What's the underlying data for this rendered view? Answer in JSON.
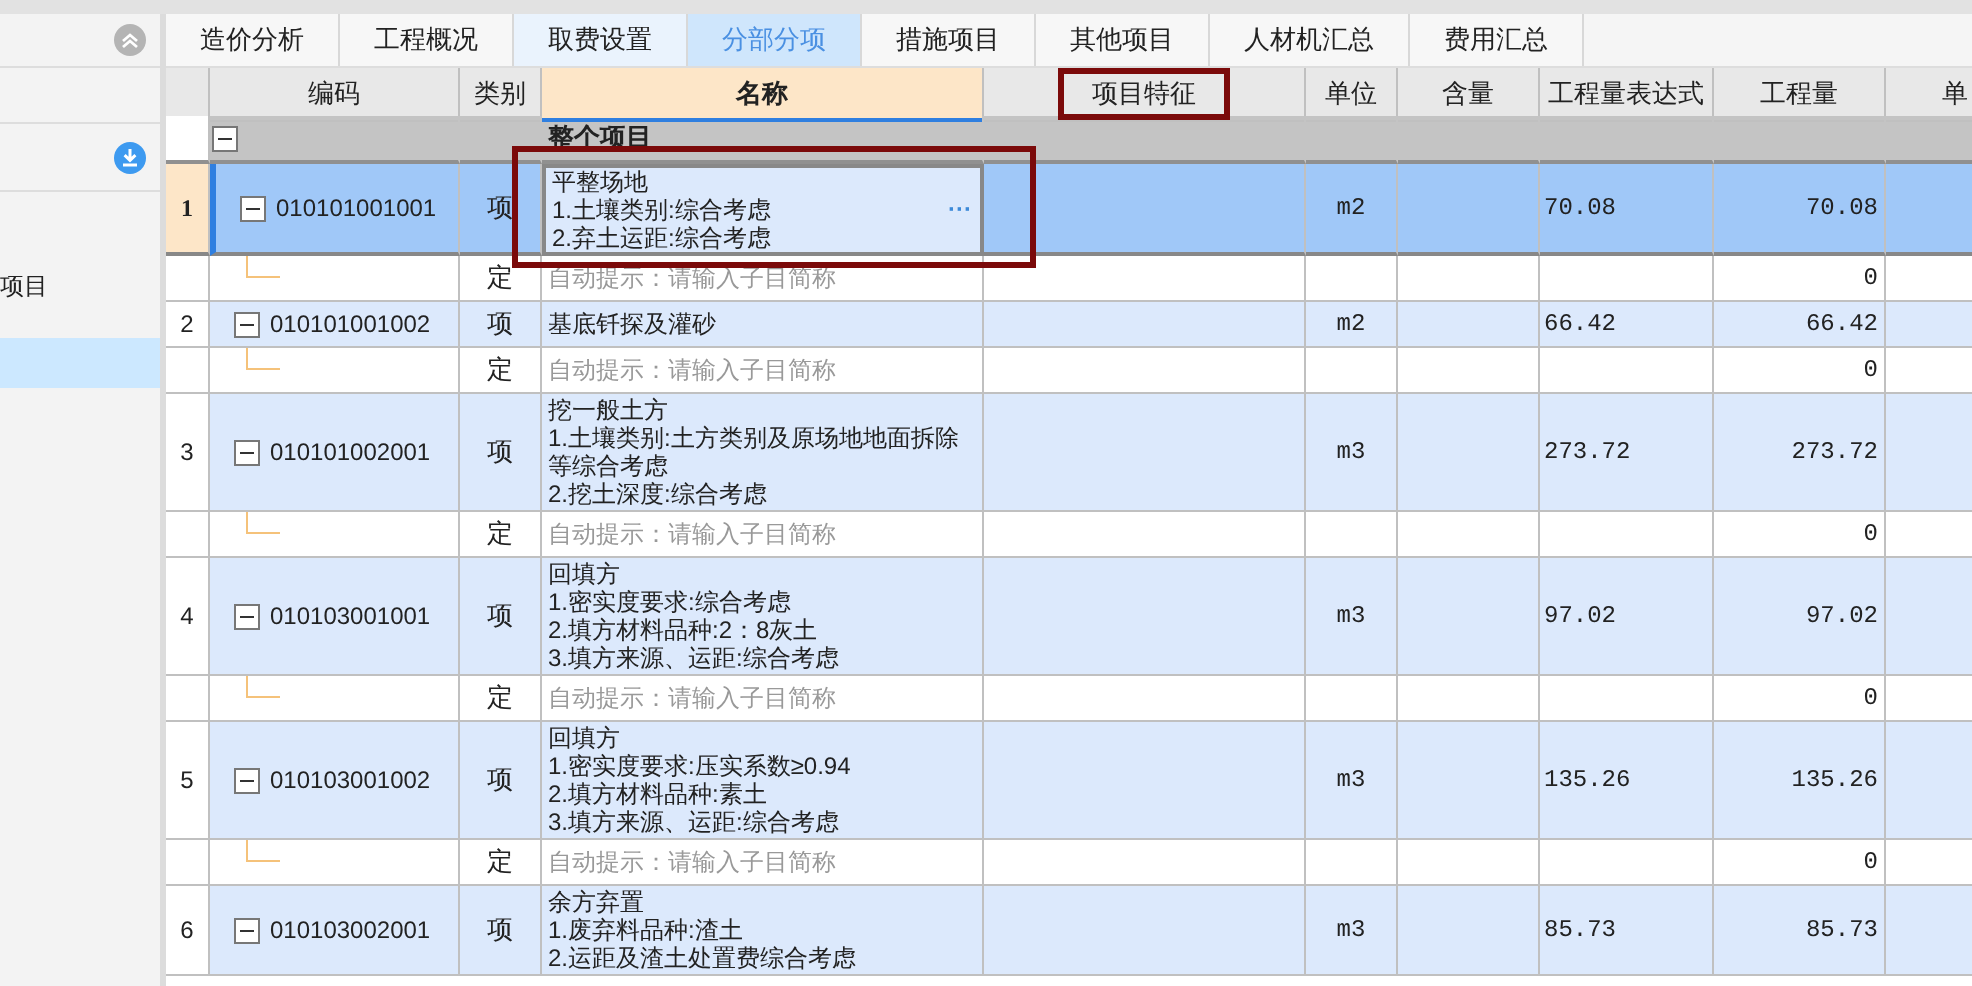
{
  "sidebar": {
    "items": [
      {
        "label": "项目",
        "selected": false
      },
      {
        "selected": true
      }
    ]
  },
  "tabs": [
    {
      "label": "造价分析",
      "selected": false,
      "highlighted": false
    },
    {
      "label": "工程概况",
      "selected": false,
      "highlighted": false
    },
    {
      "label": "取费设置",
      "selected": false,
      "highlighted": true
    },
    {
      "label": "分部分项",
      "selected": true,
      "highlighted": false
    },
    {
      "label": "措施项目",
      "selected": false,
      "highlighted": false
    },
    {
      "label": "其他项目",
      "selected": false,
      "highlighted": false
    },
    {
      "label": "人材机汇总",
      "selected": false,
      "highlighted": false
    },
    {
      "label": "费用汇总",
      "selected": false,
      "highlighted": false
    }
  ],
  "table": {
    "columns": [
      {
        "label": "编码",
        "active": false,
        "annotated": false
      },
      {
        "label": "类别",
        "active": false,
        "annotated": false
      },
      {
        "label": "名称",
        "active": true,
        "annotated": false
      },
      {
        "label": "项目特征",
        "active": false,
        "annotated": true
      },
      {
        "label": "单位",
        "active": false,
        "annotated": false
      },
      {
        "label": "含量",
        "active": false,
        "annotated": false
      },
      {
        "label": "工程量表达式",
        "active": false,
        "annotated": false
      },
      {
        "label": "工程量",
        "active": false,
        "annotated": false
      },
      {
        "label": "单",
        "active": false,
        "annotated": false
      }
    ],
    "rows": [
      {
        "kind": "group",
        "name": "整个项目",
        "expanded": true
      },
      {
        "kind": "item",
        "number": "1",
        "code": "010101001001",
        "type": "项",
        "name": "平整场地\n1.土壤类别:综合考虑\n2.弃土运距:综合考虑",
        "unit": "m2",
        "expression": "70.08",
        "quantity": "70.08",
        "selected": true,
        "annotated": true,
        "more_button": "···",
        "expanded": true
      },
      {
        "kind": "sub",
        "type": "定",
        "placeholder": "自动提示：请输入子目简称",
        "quantity": "0"
      },
      {
        "kind": "item",
        "number": "2",
        "code": "010101001002",
        "type": "项",
        "name": "基底钎探及灌砂",
        "unit": "m2",
        "expression": "66.42",
        "quantity": "66.42",
        "selected": false,
        "expanded": true
      },
      {
        "kind": "sub",
        "type": "定",
        "placeholder": "自动提示：请输入子目简称",
        "quantity": "0"
      },
      {
        "kind": "item",
        "number": "3",
        "code": "010101002001",
        "type": "项",
        "name": "挖一般土方\n1.土壤类别:土方类别及原场地地面拆除等综合考虑\n2.挖土深度:综合考虑",
        "unit": "m3",
        "expression": "273.72",
        "quantity": "273.72",
        "selected": false,
        "expanded": true
      },
      {
        "kind": "sub",
        "type": "定",
        "placeholder": "自动提示：请输入子目简称",
        "quantity": "0"
      },
      {
        "kind": "item",
        "number": "4",
        "code": "010103001001",
        "type": "项",
        "name": "回填方\n1.密实度要求:综合考虑\n2.填方材料品种:2：8灰土\n3.填方来源、运距:综合考虑",
        "unit": "m3",
        "expression": "97.02",
        "quantity": "97.02",
        "selected": false,
        "expanded": true
      },
      {
        "kind": "sub",
        "type": "定",
        "placeholder": "自动提示：请输入子目简称",
        "quantity": "0"
      },
      {
        "kind": "item",
        "number": "5",
        "code": "010103001002",
        "type": "项",
        "name": "回填方\n1.密实度要求:压实系数≥0.94\n2.填方材料品种:素土\n3.填方来源、运距:综合考虑",
        "unit": "m3",
        "expression": "135.26",
        "quantity": "135.26",
        "selected": false,
        "expanded": true
      },
      {
        "kind": "sub",
        "type": "定",
        "placeholder": "自动提示：请输入子目简称",
        "quantity": "0"
      },
      {
        "kind": "item",
        "number": "6",
        "code": "010103002001",
        "type": "项",
        "name": "余方弃置\n1.废弃料品种:渣土\n2.运距及渣土处置费综合考虑",
        "unit": "m3",
        "expression": "85.73",
        "quantity": "85.73",
        "selected": false,
        "expanded": true
      }
    ]
  }
}
